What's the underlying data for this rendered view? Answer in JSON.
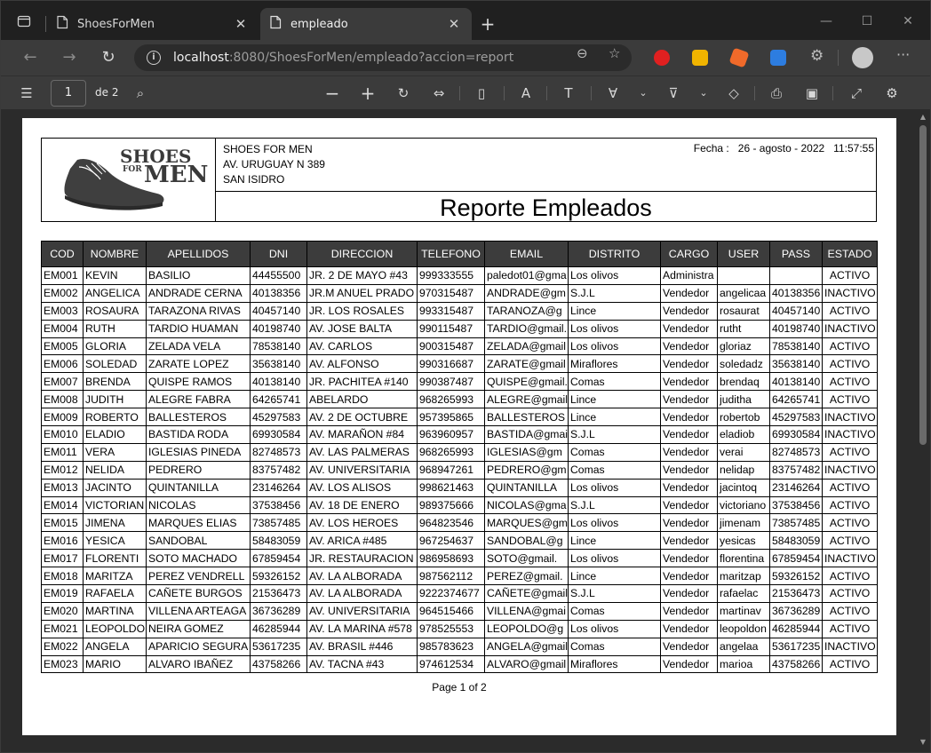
{
  "browser": {
    "tabs": [
      {
        "title": "ShoesForMen",
        "active": false
      },
      {
        "title": "empleado",
        "active": true
      }
    ],
    "url_host": "localhost",
    "url_rest": ":8080/ShoesForMen/empleado?accion=report"
  },
  "pdf_toolbar": {
    "page_current": "1",
    "page_of": "de 2"
  },
  "report": {
    "company_name": "SHOES FOR MEN",
    "company_address": "AV. URUGUAY N 389",
    "company_district": "SAN ISIDRO",
    "fecha": "Fecha :   26 - agosto - 2022   11:57:55",
    "logo_top": "SHOES",
    "logo_for": "FOR",
    "logo_bottom": "MEN",
    "title": "Reporte Empleados",
    "footer": "Page 1 of 2",
    "columns": [
      "COD",
      "NOMBRE",
      "APELLIDOS",
      "DNI",
      "DIRECCION",
      "TELEFONO",
      "EMAIL",
      "DISTRITO",
      "CARGO",
      "USER",
      "PASS",
      "ESTADO"
    ],
    "rows": [
      [
        "EM001",
        "KEVIN",
        "BASILIO",
        "44455500",
        "JR. 2 DE MAYO #43",
        "999333555",
        "paledot01@gma",
        "Los olivos",
        "Administra",
        "",
        "",
        "ACTIVO"
      ],
      [
        "EM002",
        "ANGELICA",
        "ANDRADE CERNA",
        "40138356",
        "JR.M ANUEL PRADO",
        "970315487",
        "ANDRADE@gm",
        "S.J.L",
        "Vendedor",
        "angelicaa",
        "40138356",
        "INACTIVO"
      ],
      [
        "EM003",
        "ROSAURA",
        "TARAZONA RIVAS",
        "40457140",
        "JR. LOS ROSALES",
        "993315487",
        "TARANOZA@g",
        "Lince",
        "Vendedor",
        "rosaurat",
        "40457140",
        "ACTIVO"
      ],
      [
        "EM004",
        "RUTH",
        "TARDIO HUAMAN",
        "40198740",
        "AV. JOSE BALTA",
        "990115487",
        "TARDIO@gmail.",
        "Los olivos",
        "Vendedor",
        "rutht",
        "40198740",
        "INACTIVO"
      ],
      [
        "EM005",
        "GLORIA",
        "ZELADA VELA",
        "78538140",
        "AV. CARLOS",
        "900315487",
        "ZELADA@gmail",
        "Los olivos",
        "Vendedor",
        "gloriaz",
        "78538140",
        "ACTIVO"
      ],
      [
        "EM006",
        "SOLEDAD",
        "ZARATE LOPEZ",
        "35638140",
        "AV. ALFONSO",
        "990316687",
        "ZARATE@gmail",
        "Miraflores",
        "Vendedor",
        "soledadz",
        "35638140",
        "ACTIVO"
      ],
      [
        "EM007",
        "BRENDA",
        "QUISPE RAMOS",
        "40138140",
        "JR. PACHITEA #140",
        "990387487",
        "QUISPE@gmail.",
        "Comas",
        "Vendedor",
        "brendaq",
        "40138140",
        "ACTIVO"
      ],
      [
        "EM008",
        "JUDITH",
        "ALEGRE FABRA",
        "64265741",
        "ABELARDO",
        "968265993",
        "ALEGRE@gmail",
        "Lince",
        "Vendedor",
        "juditha",
        "64265741",
        "ACTIVO"
      ],
      [
        "EM009",
        "ROBERTO",
        "BALLESTEROS",
        "45297583",
        "AV. 2 DE OCTUBRE",
        "957395865",
        "BALLESTEROS",
        "Lince",
        "Vendedor",
        "robertob",
        "45297583",
        "INACTIVO"
      ],
      [
        "EM010",
        "ELADIO",
        "BASTIDA RODA",
        "69930584",
        "AV. MARAÑON #84",
        "963960957",
        "BASTIDA@gmai",
        "S.J.L",
        "Vendedor",
        "eladiob",
        "69930584",
        "INACTIVO"
      ],
      [
        "EM011",
        "VERA",
        "IGLESIAS PINEDA",
        "82748573",
        "AV. LAS PALMERAS",
        "968265993",
        "IGLESIAS@gm",
        "Comas",
        "Vendedor",
        "verai",
        "82748573",
        "ACTIVO"
      ],
      [
        "EM012",
        "NELIDA",
        "PEDRERO",
        "83757482",
        "AV. UNIVERSITARIA",
        "968947261",
        "PEDRERO@gm",
        "Comas",
        "Vendedor",
        "nelidap",
        "83757482",
        "INACTIVO"
      ],
      [
        "EM013",
        "JACINTO",
        "QUINTANILLA",
        "23146264",
        "AV. LOS ALISOS",
        "998621463",
        "QUINTANILLA",
        "Los olivos",
        "Vendedor",
        "jacintoq",
        "23146264",
        "ACTIVO"
      ],
      [
        "EM014",
        "VICTORIAN",
        "NICOLAS",
        "37538456",
        "AV. 18 DE ENERO",
        "989375666",
        "NICOLAS@gma",
        "S.J.L",
        "Vendedor",
        "victoriano",
        "37538456",
        "ACTIVO"
      ],
      [
        "EM015",
        "JIMENA",
        "MARQUES ELIAS",
        "73857485",
        "AV. LOS HEROES",
        "964823546",
        "MARQUES@gm",
        "Los olivos",
        "Vendedor",
        "jimenam",
        "73857485",
        "ACTIVO"
      ],
      [
        "EM016",
        "YESICA",
        "SANDOBAL",
        "58483059",
        "AV. ARICA #485",
        "967254637",
        "SANDOBAL@g",
        "Lince",
        "Vendedor",
        "yesicas",
        "58483059",
        "ACTIVO"
      ],
      [
        "EM017",
        "FLORENTI",
        "SOTO MACHADO",
        "67859454",
        "JR. RESTAURACION",
        "986958693",
        "SOTO@gmail.",
        "Los olivos",
        "Vendedor",
        "florentina",
        "67859454",
        "INACTIVO"
      ],
      [
        "EM018",
        "MARITZA",
        "PEREZ VENDRELL",
        "59326152",
        "AV. LA ALBORADA",
        "987562112",
        "PEREZ@gmail.",
        "Lince",
        "Vendedor",
        "maritzap",
        "59326152",
        "ACTIVO"
      ],
      [
        "EM019",
        "RAFAELA",
        "CAÑETE BURGOS",
        "21536473",
        "AV. LA ALBORADA",
        "9222374677",
        "CAÑETE@gmail",
        "S.J.L",
        "Vendedor",
        "rafaelac",
        "21536473",
        "ACTIVO"
      ],
      [
        "EM020",
        "MARTINA",
        "VILLENA ARTEAGA",
        "36736289",
        "AV. UNIVERSITARIA",
        "964515466",
        "VILLENA@gmai",
        "Comas",
        "Vendedor",
        "martinav",
        "36736289",
        "ACTIVO"
      ],
      [
        "EM021",
        "LEOPOLDO",
        "NEIRA GOMEZ",
        "46285944",
        "AV. LA MARINA #578",
        "978525553",
        "LEOPOLDO@g",
        "Los olivos",
        "Vendedor",
        "leopoldon",
        "46285944",
        "ACTIVO"
      ],
      [
        "EM022",
        "ANGELA",
        "APARICIO SEGURA",
        "53617235",
        "AV. BRASIL #446",
        "985783623",
        "ANGELA@gmail",
        "Comas",
        "Vendedor",
        "angelaa",
        "53617235",
        "INACTIVO"
      ],
      [
        "EM023",
        "MARIO",
        "ALVARO IBAÑEZ",
        "43758266",
        "AV. TACNA #43",
        "974612534",
        "ALVARO@gmail",
        "Miraflores",
        "Vendedor",
        "marioa",
        "43758266",
        "ACTIVO"
      ]
    ]
  },
  "colors": {
    "chrome_bg": "#202020",
    "toolbar_bg": "#3b3b3b",
    "table_header_bg": "#3c3c3c",
    "ext_red": "#e02020",
    "ext_yellow": "#f0b400",
    "ext_blue": "#2d7de0"
  },
  "icons": [
    "tab-actions-icon",
    "page-icon",
    "close-icon",
    "plus-icon",
    "minimize-icon",
    "maximize-icon",
    "back-icon",
    "forward-icon",
    "refresh-icon",
    "info-icon",
    "zoom-icon",
    "favorite-icon",
    "profile-icon",
    "more-icon",
    "contents-icon",
    "search-icon",
    "zoom-out-icon",
    "zoom-in-icon",
    "rotate-icon",
    "fit-page-icon",
    "page-view-icon",
    "read-aloud-icon",
    "text-icon",
    "draw-icon",
    "highlight-icon",
    "erase-icon",
    "print-icon",
    "save-icon",
    "fullscreen-icon",
    "settings-icon",
    "shoe-logo-icon"
  ]
}
